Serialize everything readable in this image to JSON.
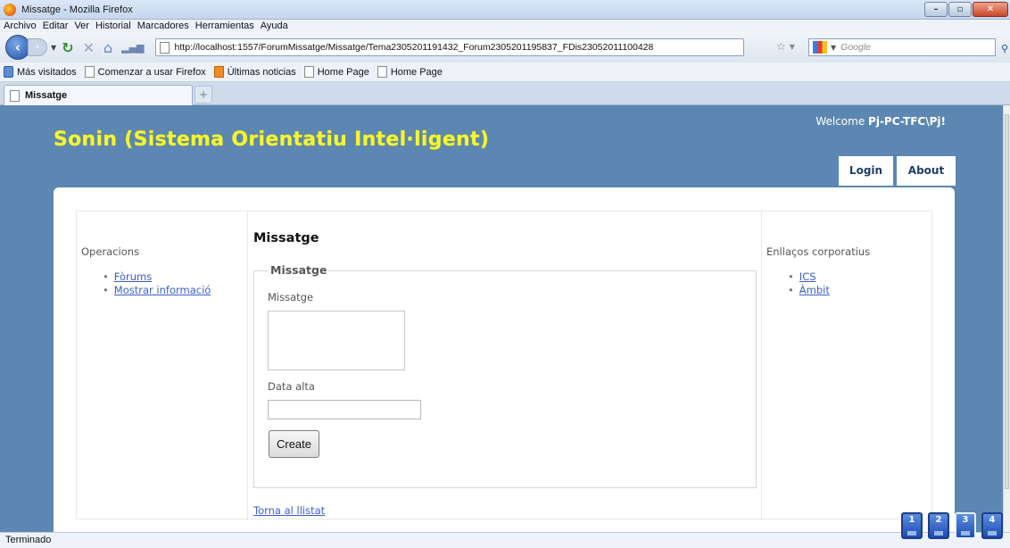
{
  "window": {
    "title": "Missatge - Mozilla Firefox",
    "buttons": [
      "–",
      "▫",
      "✕"
    ]
  },
  "menu": {
    "items": [
      "Archivo",
      "Editar",
      "Ver",
      "Historial",
      "Marcadores",
      "Herramientas",
      "Ayuda"
    ]
  },
  "nav": {
    "url": "http://localhost:1557/ForumMissatge/Missatge/Tema2305201191432_Forum2305201195837_FDis23052011100428",
    "search_placeholder": "Google"
  },
  "bookmarks": [
    "Más visitados",
    "Comenzar a usar Firefox",
    "Últimas noticias",
    "Home Page",
    "Home Page"
  ],
  "tab": {
    "label": "Missatge",
    "new_tab": "+"
  },
  "site": {
    "welcome_prefix": "Welcome ",
    "welcome_user": "Pj-PC-TFC\\Pj",
    "welcome_suffix": "!",
    "title": "Sonin (Sistema Orientatiu Intel·ligent)",
    "menu": [
      "Login",
      "About"
    ]
  },
  "left": {
    "heading": "Operacions",
    "links": [
      "Fòrums",
      "Mostrar informació"
    ]
  },
  "main": {
    "title": "Missatge",
    "legend": "Missatge",
    "field1_label": "Missatge",
    "field2_label": "Data alta",
    "create_label": "Create",
    "back_link": "Torna al llistat"
  },
  "right": {
    "heading": "Enllaços corporatius",
    "links": [
      "ICS",
      "Àmbit"
    ]
  },
  "status": {
    "text": "Terminado"
  },
  "desktops": [
    "1",
    "2",
    "3",
    "4"
  ]
}
